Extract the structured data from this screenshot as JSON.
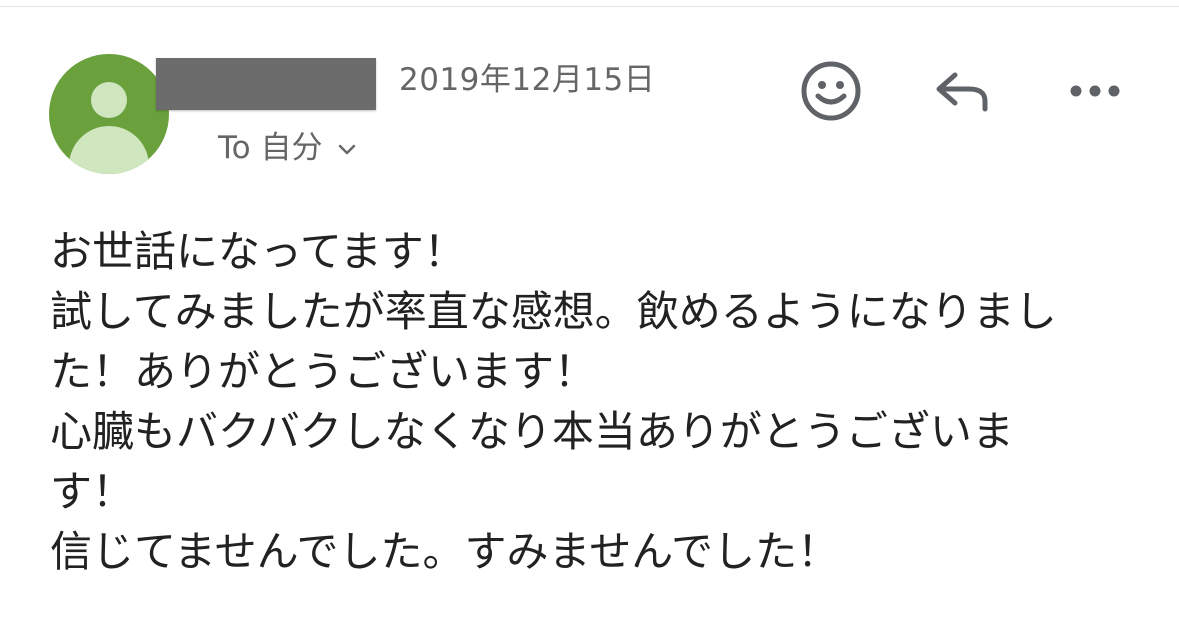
{
  "header": {
    "date": "2019年12月15日",
    "recipient_label": "To 自分"
  },
  "icons": {
    "avatar": "avatar-person-icon",
    "add_reaction": "smiley-face-icon",
    "reply": "reply-arrow-icon",
    "more": "more-horizontal-icon",
    "recipient_toggle": "chevron-down-icon"
  },
  "colors": {
    "avatar_bg": "#6aa13c",
    "avatar_fg": "#cfe6bf",
    "redaction": "#6c6c6c",
    "secondary_text": "#666666",
    "icon": "#5f6368",
    "body_text": "#222222"
  },
  "message": {
    "lines": [
      "お世話になってます！",
      "試してみましたが率直な感想。飲めるようになりまし",
      "た！ありがとうございます！",
      "心臓もバクバクしなくなり本当ありがとうございま",
      "す！",
      "信じてませんでした。すみませんでした！"
    ]
  }
}
